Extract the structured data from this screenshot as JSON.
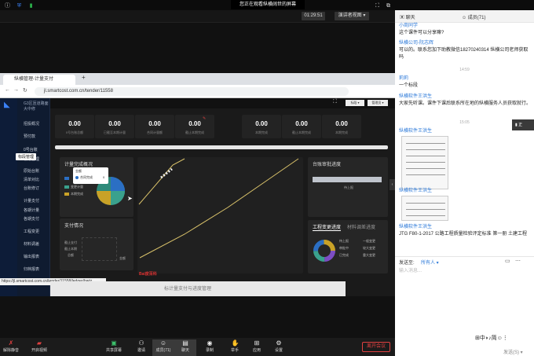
{
  "meeting": {
    "banner": "您正在观看纵横阔世的屏幕",
    "clock": "01:29:51",
    "view_label": "演讲者视图 ▾"
  },
  "browser": {
    "tab_title": "纵横管理-计量支付",
    "url": "jl.smartcost.com.cn/tender/11558",
    "status_url": "https://jl.smartcost.com.cn/tender/11558/ledger/bwtz"
  },
  "app": {
    "project": "G3区匝道路面大中修",
    "nav": [
      "招投概况",
      "预付款",
      "0号台账",
      "标段管理",
      "原始台账",
      "清单对比",
      "台账修订",
      "计量支付",
      "各期计量",
      "各期支付",
      "工程变更",
      "材料调差",
      "输出报表",
      "归档报表"
    ],
    "tooltip": "标段管理",
    "top_buttons": [
      "标段 ▾",
      "管理员 ▾"
    ],
    "stats": [
      {
        "value": "0.00",
        "label": "0号台账总额"
      },
      {
        "value": "0.00",
        "label": "已截至本期计量"
      },
      {
        "value": "0.00",
        "label": "合同计量额"
      },
      {
        "value": "0.00",
        "label": "截止本期完成"
      },
      {
        "value": "0.00",
        "label": "本期完成"
      },
      {
        "value": "0.00",
        "label": "截止本期完成"
      },
      {
        "value": "0.00",
        "label": "本期完成"
      }
    ],
    "panels": {
      "plan": "计量完成概况",
      "pay": "支付情况",
      "approve": "台账审批进度",
      "change_tab1": "工程变更进度",
      "change_tab2": "材料调差进度"
    },
    "plan_tip": {
      "head": "金额",
      "row_label": "合同完成",
      "row_value": "0"
    },
    "plan_legend": [
      "合同计量",
      "变更计量",
      "本期完成"
    ],
    "pay_labels": [
      "截止支付",
      "截止本期",
      "总额"
    ],
    "pay_note": "金额",
    "approve_progress": "待上报",
    "change_legend": [
      "待上报",
      "一般变更",
      "审批中",
      "较大变更",
      "已完成",
      "重大变更"
    ],
    "bottom_caption": "标计量支付与进度管理",
    "watermark": "Bai度百科"
  },
  "chat": {
    "header_left": "聊天",
    "header_right": "成员(71)",
    "messages": [
      {
        "name": "小商同学",
        "text": "这个课件可以分享嘛?"
      },
      {
        "name": "纵横公司-阮志辉",
        "text": "可以的。联系您加下助教微信18270240314 纵横公司老师获取吗"
      },
      {
        "time": "14:59"
      },
      {
        "name": "莉莉",
        "text": "一个标段"
      },
      {
        "name": "纵横软件王洪生",
        "text": "大家先听课。课件下课后联系所在地的纵横服务人员获取就行。"
      },
      {
        "time": "15:05"
      },
      {
        "name": "纵横软件王洪生",
        "text": ""
      },
      {
        "name": "纵横软件王洪生",
        "text": ""
      },
      {
        "name": "纵横软件王洪生",
        "text": "JTG F80-1-2017 公路工程质量检验评定标准 第一册 土建工程"
      }
    ],
    "send_to_label": "发送至:",
    "send_to_value": "所有人 ▾",
    "input_placeholder": "输入消息...",
    "send_button": "发送(S) ▾",
    "speaker_tag": "正"
  },
  "toolbar": {
    "items": [
      "解除静音",
      "开启视频",
      "共享屏幕",
      "邀请",
      "成员(71)",
      "聊天",
      "录制",
      "举手",
      "应用",
      "设置"
    ],
    "leave": "离开会议"
  }
}
